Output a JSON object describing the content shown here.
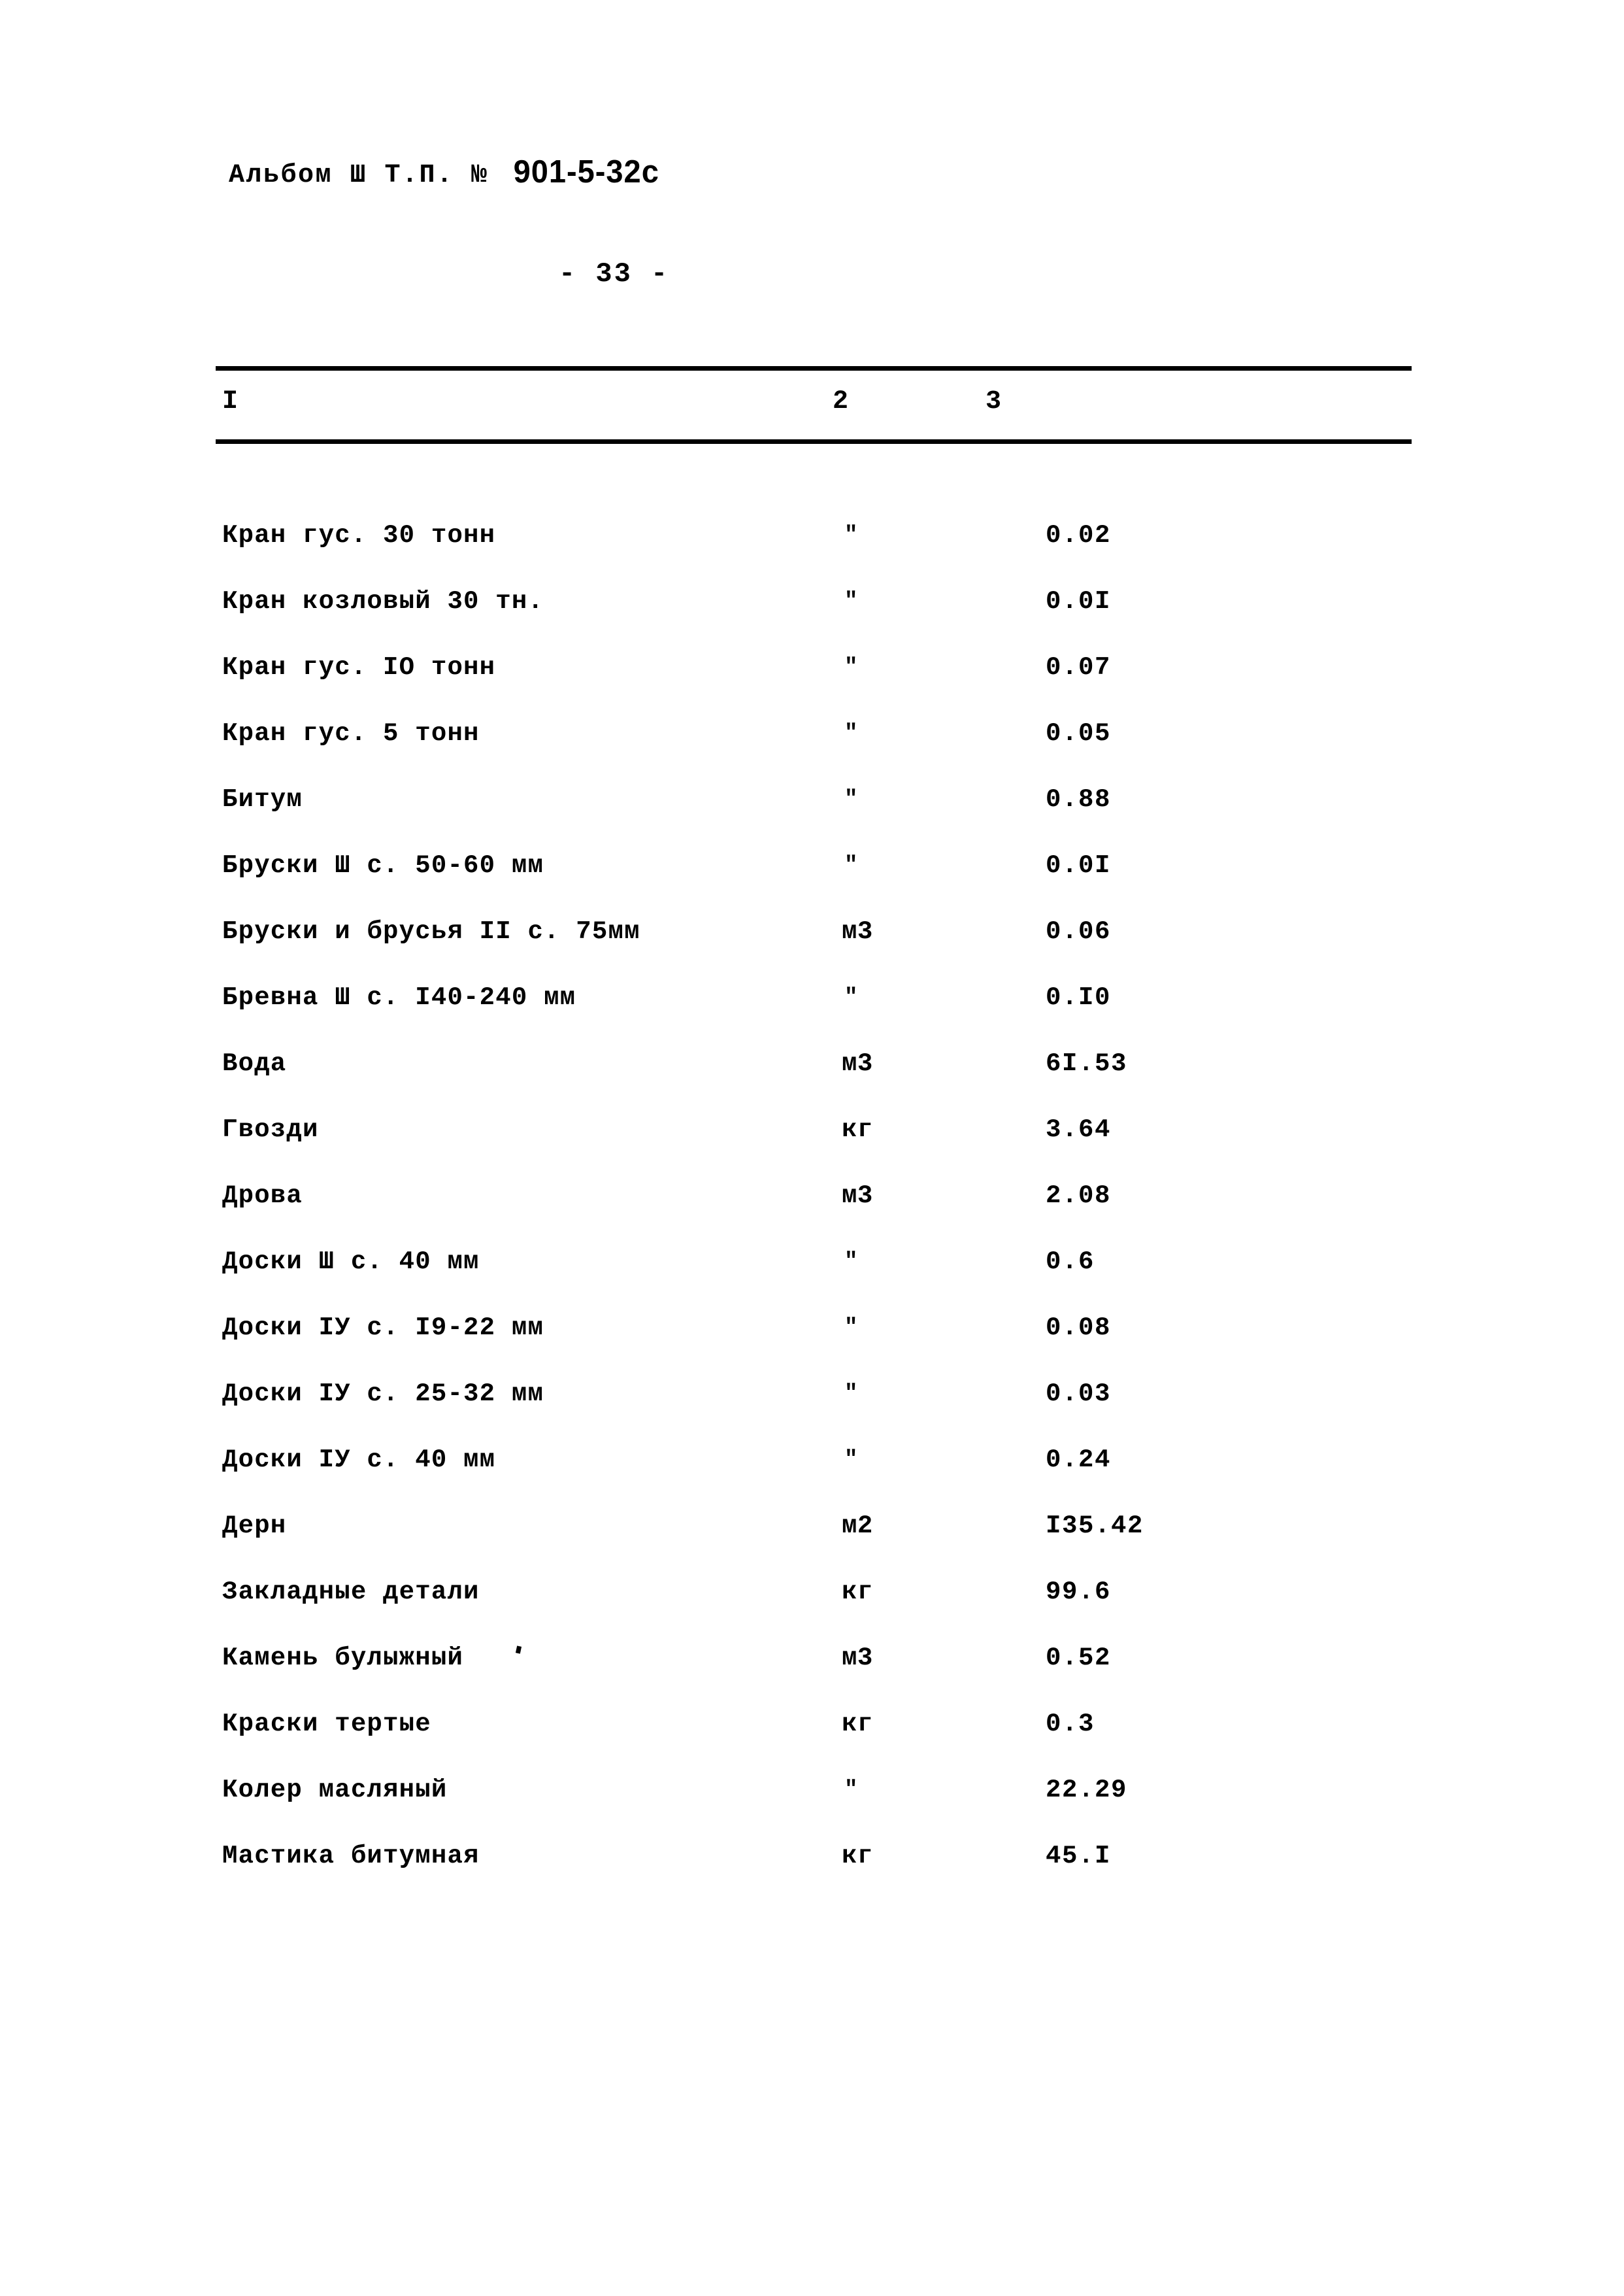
{
  "header": {
    "album_label": "Альбом Ш Т.П. №",
    "document_code": "901-5-32с",
    "page_number": "- 33 -"
  },
  "table": {
    "column_numbers": [
      "I",
      "2",
      "3"
    ],
    "rows": [
      {
        "name": "Кран гус. 30 тонн",
        "unit": "\"",
        "value": "0.02"
      },
      {
        "name": "Кран козловый 30 тн.",
        "unit": "\"",
        "value": "0.0I"
      },
      {
        "name": "Кран гус. IO тонн",
        "unit": "\"",
        "value": "0.07"
      },
      {
        "name": "Кран гус. 5 тонн",
        "unit": "\"",
        "value": "0.05"
      },
      {
        "name": "Битум",
        "unit": "\"",
        "value": "0.88"
      },
      {
        "name": "Бруски Ш с. 50-60 мм",
        "unit": "\"",
        "value": "0.0I"
      },
      {
        "name": "Бруски и брусья II с. 75мм",
        "unit": "м3",
        "value": "0.06"
      },
      {
        "name": "Бревна Ш с. I40-240 мм",
        "unit": "\"",
        "value": "0.I0"
      },
      {
        "name": "Вода",
        "unit": "м3",
        "value": "6I.53"
      },
      {
        "name": "Гвозди",
        "unit": "кг",
        "value": "3.64"
      },
      {
        "name": "Дрова",
        "unit": "м3",
        "value": "2.08"
      },
      {
        "name": "Доски Ш с. 40 мм",
        "unit": "\"",
        "value": "0.6"
      },
      {
        "name": "Доски IУ с. I9-22 мм",
        "unit": "\"",
        "value": "0.08"
      },
      {
        "name": "Доски IУ с. 25-32 мм",
        "unit": "\"",
        "value": "0.03"
      },
      {
        "name": "Доски IУ с. 40 мм",
        "unit": "\"",
        "value": "0.24"
      },
      {
        "name": "Дерн",
        "unit": "м2",
        "value": "I35.42"
      },
      {
        "name": "Закладные детали",
        "unit": "кг",
        "value": "99.6"
      },
      {
        "name": "Камень булыжный",
        "unit": "м3",
        "value": "0.52"
      },
      {
        "name": "Краски тертые",
        "unit": "кг",
        "value": "0.3"
      },
      {
        "name": "Колер масляный",
        "unit": "\"",
        "value": "22.29"
      },
      {
        "name": "Мастика битумная",
        "unit": "кг",
        "value": "45.I"
      }
    ]
  }
}
